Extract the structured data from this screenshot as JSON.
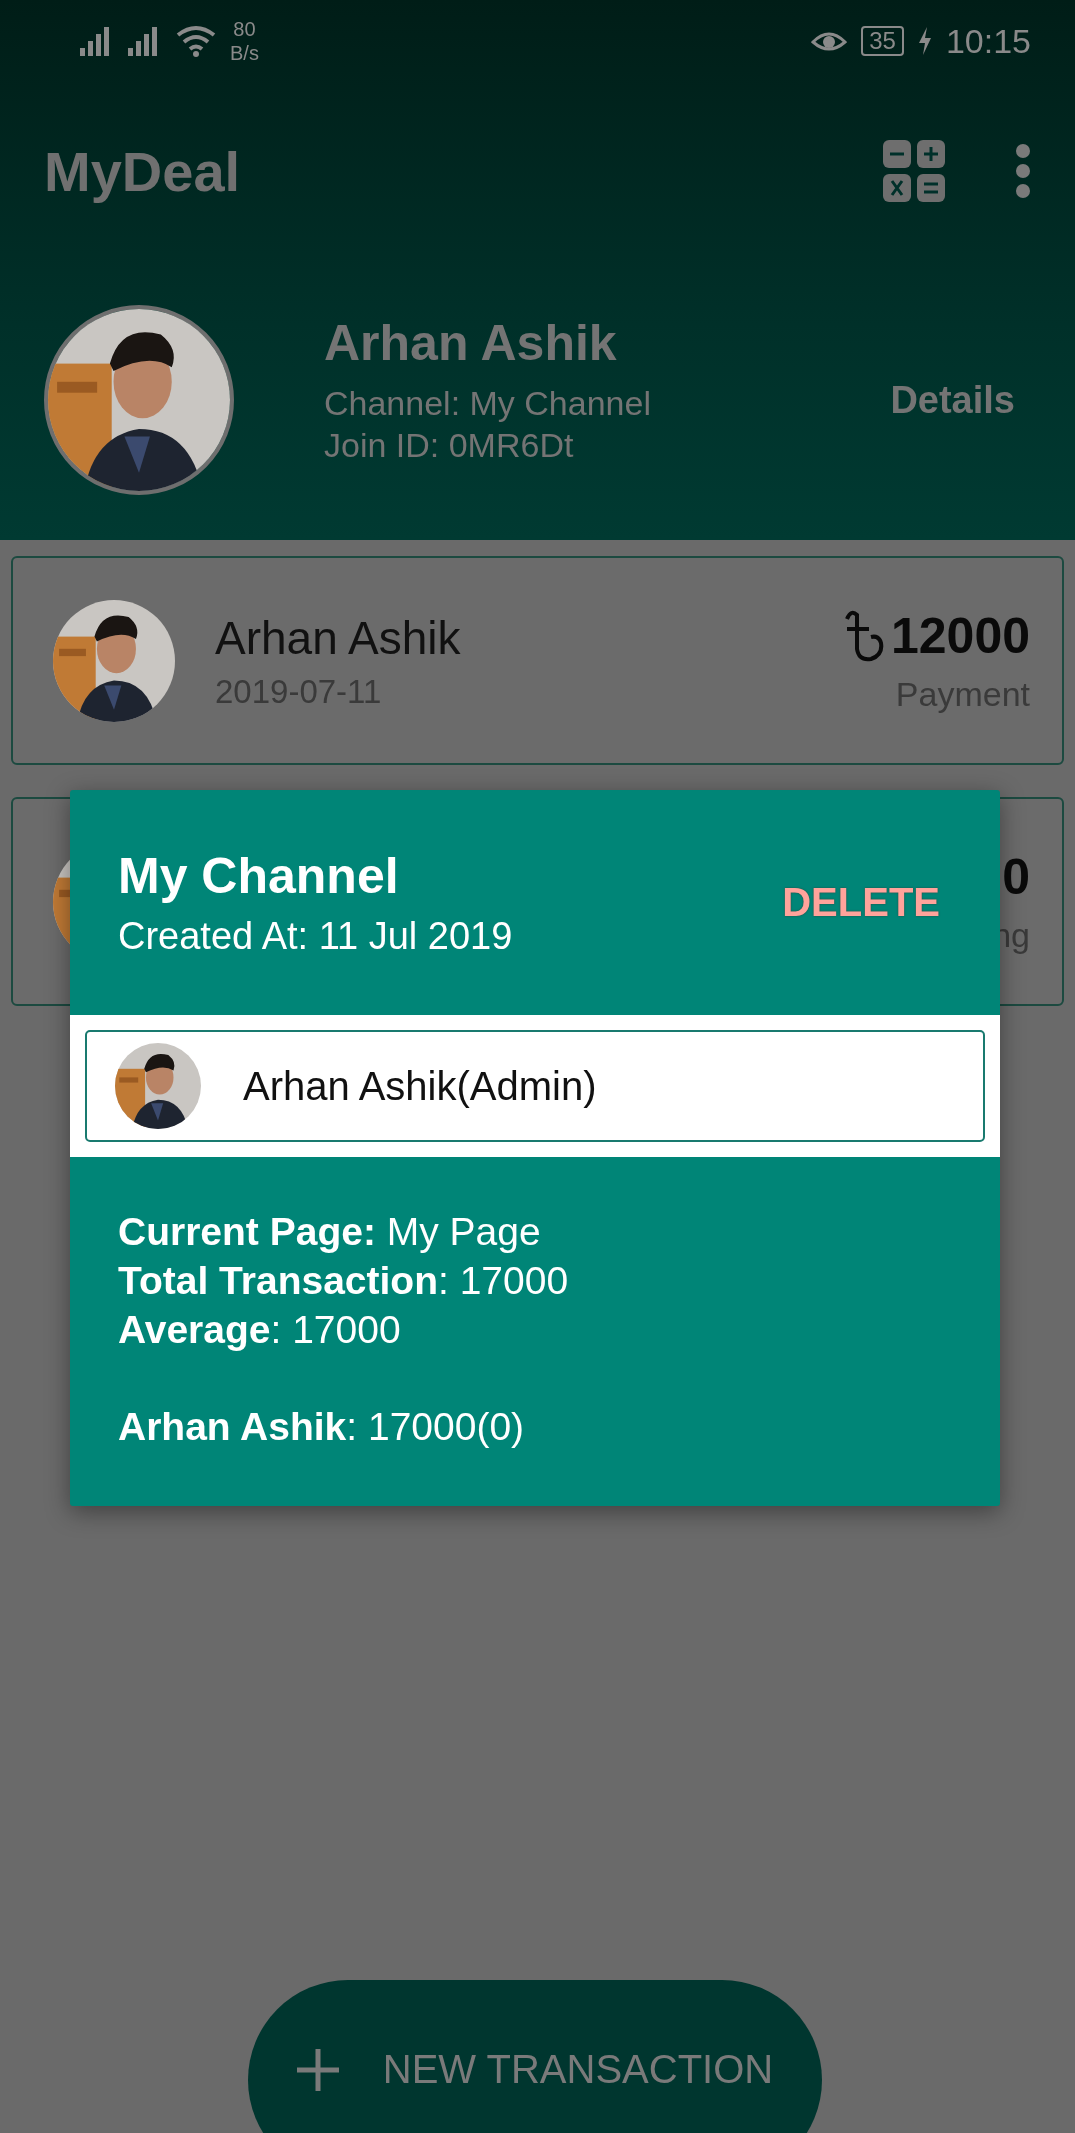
{
  "status_bar": {
    "network_speed": "80",
    "network_speed_unit": "B/s",
    "battery": "35",
    "time": "10:15"
  },
  "app_bar": {
    "title": "MyDeal"
  },
  "profile": {
    "name": "Arhan Ashik",
    "channel": "Channel: My Channel",
    "join_id": "Join ID: 0MR6Dt",
    "action": "Details"
  },
  "transactions": [
    {
      "kind": "full",
      "name": "Arhan Ashik",
      "date": "2019-07-11",
      "amount": "12000",
      "type": "Payment"
    },
    {
      "kind": "covered",
      "amount": "0",
      "type": "ng"
    }
  ],
  "dialog": {
    "title": "My Channel",
    "created": "Created At: 11 Jul 2019",
    "action": "DELETE",
    "members": [
      {
        "label": "Arhan Ashik(Admin)"
      }
    ],
    "stats": [
      [
        "**Current Page:** My Page",
        "**Total Transaction**: 17000",
        "**Average**: 17000"
      ],
      [
        "**Arhan Ashik**: 17000(0)"
      ]
    ]
  },
  "fab": {
    "label": "NEW TRANSACTION"
  }
}
